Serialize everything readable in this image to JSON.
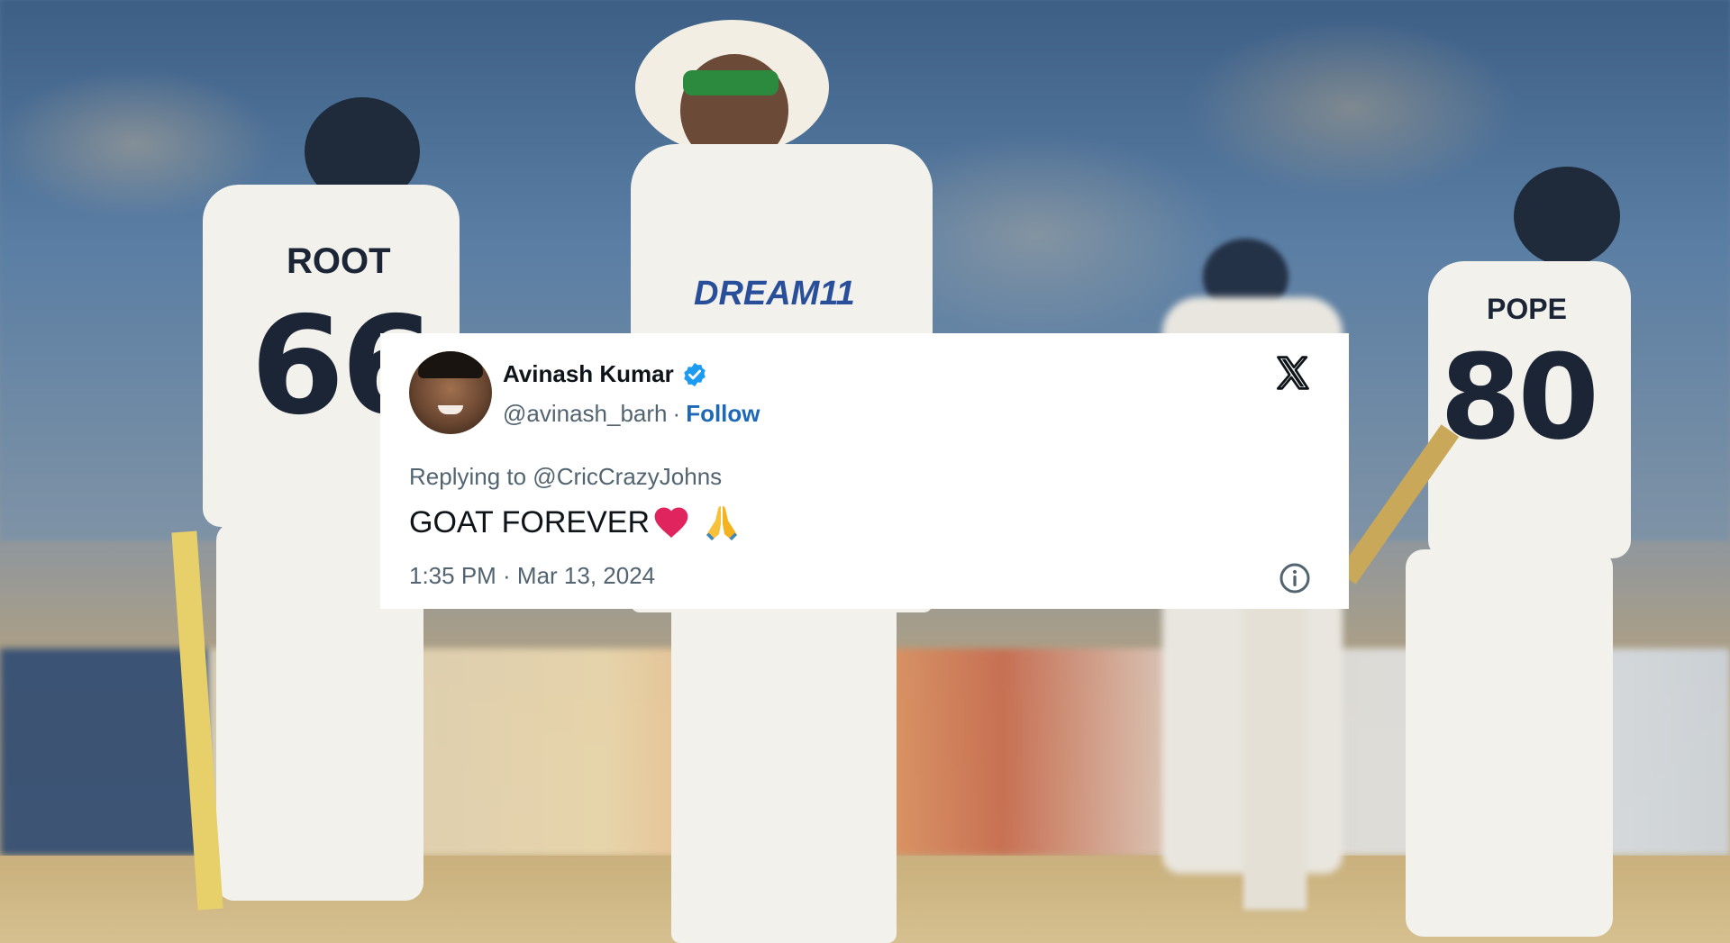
{
  "tweet": {
    "author_name": "Avinash Kumar",
    "handle": "@avinash_barh",
    "separator": "·",
    "follow_label": "Follow",
    "replying_to": "Replying to @CricCrazyJohns",
    "text": "GOAT FOREVER",
    "emojis": [
      "heart-emoji",
      "folded-hands-emoji"
    ],
    "timestamp": "1:35 PM · Mar 13, 2024",
    "verified": true
  },
  "background": {
    "jersey_left_name": "ROOT",
    "jersey_left_number": "66",
    "jersey_center_sponsor": "DREAM11",
    "jersey_right_name": "POPE",
    "jersey_right_number": "80"
  },
  "colors": {
    "follow": "#1d68b8",
    "verified": "#1d9bf0",
    "heart": "#e0245e",
    "secondary_text": "#536471"
  }
}
